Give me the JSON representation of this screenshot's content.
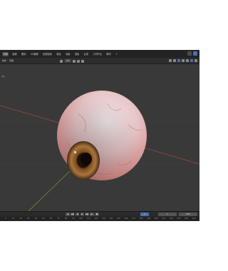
{
  "menu": {
    "items": [
      "布局",
      "建模",
      "雕刻",
      "UV编辑",
      "纹理绘制",
      "着色",
      "动画",
      "渲染",
      "合成",
      "几何节点",
      "脚本",
      "+"
    ]
  },
  "toolbar": {
    "left": [
      "物体",
      "视图"
    ],
    "transform": "全局",
    "stat_label": "ms"
  },
  "timeline": {
    "buttons": [
      "|◀",
      "◀◀",
      "◀",
      "▶",
      "▶▶",
      "▶|",
      "●"
    ],
    "current_frame": "1",
    "start_frame": "1",
    "end_frame": "250",
    "ticks": [
      "0",
      "10",
      "20",
      "30",
      "40",
      "50",
      "60",
      "70",
      "80",
      "90",
      "100",
      "110",
      "120",
      "130",
      "140",
      "150",
      "160",
      "170",
      "180",
      "190",
      "200",
      "210",
      "220",
      "230",
      "240",
      "250"
    ]
  },
  "colors": {
    "accent": "#4772b3",
    "background": "#393939",
    "x_axis": "#b34a4a",
    "y_axis": "#7fa33a"
  },
  "viewport_object": "eyeball"
}
